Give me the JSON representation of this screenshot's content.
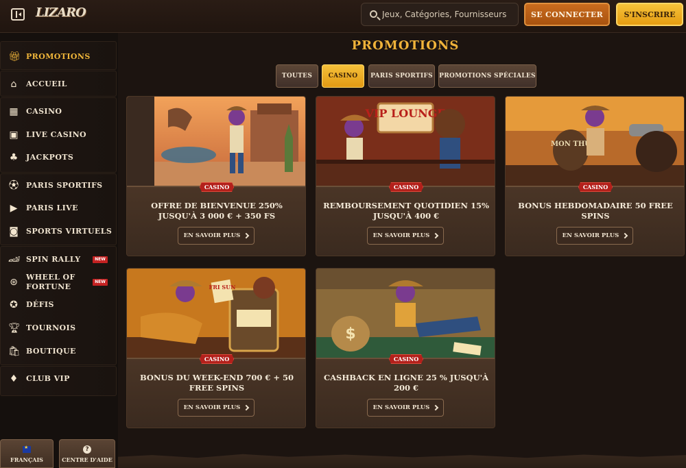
{
  "header": {
    "logo_text": "LIZARO",
    "search_placeholder": "Jeux, Catégories, Fournisseurs",
    "login_label": "SE CONNECTER",
    "signup_label": "S'INSCRIRE"
  },
  "sidebar": {
    "items": [
      {
        "label": "PROMOTIONS",
        "icon": "gift-icon"
      },
      {
        "label": "ACCUEIL",
        "icon": "home-icon"
      },
      {
        "label": "CASINO",
        "icon": "casino-icon"
      },
      {
        "label": "LIVE CASINO",
        "icon": "live-casino-icon"
      },
      {
        "label": "JACKPOTS",
        "icon": "clover-icon"
      },
      {
        "label": "PARIS SPORTIFS",
        "icon": "soccer-ball-icon"
      },
      {
        "label": "PARIS LIVE",
        "icon": "play-icon"
      },
      {
        "label": "SPORTS VIRTUELS",
        "icon": "virtual-sports-icon"
      },
      {
        "label": "SPIN RALLY",
        "icon": "car-icon",
        "badge": "NEW"
      },
      {
        "label": "WHEEL OF FORTUNE",
        "label_line1": "WHEEL OF",
        "label_line2": "FORTUNE",
        "icon": "wheel-icon",
        "badge": "NEW"
      },
      {
        "label": "DÉFIS",
        "icon": "medal-icon"
      },
      {
        "label": "TOURNOIS",
        "icon": "trophy-icon"
      },
      {
        "label": "BOUTIQUE",
        "icon": "shop-bag-icon"
      },
      {
        "label": "CLUB VIP",
        "icon": "diamond-icon"
      }
    ],
    "footer": {
      "language_label": "FRANÇAIS",
      "help_label": "CENTRE D'AIDE"
    }
  },
  "main": {
    "title": "PROMOTIONS",
    "filters": [
      "TOUTES",
      "CASINO",
      "PARIS SPORTIFS",
      "PROMOTIONS SPÉCIALES"
    ],
    "active_filter": "CASINO",
    "cards": [
      {
        "tag": "CASINO",
        "title": "OFFRE DE BIENVENUE 250% JUSQU'À 3 000 € + 350 FS",
        "cta": "EN SAVOIR PLUS"
      },
      {
        "tag": "CASINO",
        "title": "REMBOURSEMENT QUOTIDIEN 15% JUSQU'À 400 €",
        "cta": "EN SAVOIR PLUS",
        "art_text": "VIP LOUNGE"
      },
      {
        "tag": "CASINO",
        "title": "BONUS HEBDOMADAIRE 50 FREE SPINS",
        "cta": "EN SAVOIR PLUS",
        "art_text": "MON THU"
      },
      {
        "tag": "CASINO",
        "title": "BONUS DU WEEK-END 700 € + 50 FREE SPINS",
        "cta": "EN SAVOIR PLUS",
        "art_text": "FRI SUN"
      },
      {
        "tag": "CASINO",
        "title": "CASHBACK EN LIGNE 25 % JUSQU'À 200 €",
        "cta": "EN SAVOIR PLUS"
      }
    ]
  },
  "colors": {
    "accent_gold": "#f0b33a",
    "login_orange": "#c96b1e",
    "signup_yellow": "#f6c33a",
    "casino_tag_red": "#b3201b",
    "background": "#1a1210"
  }
}
